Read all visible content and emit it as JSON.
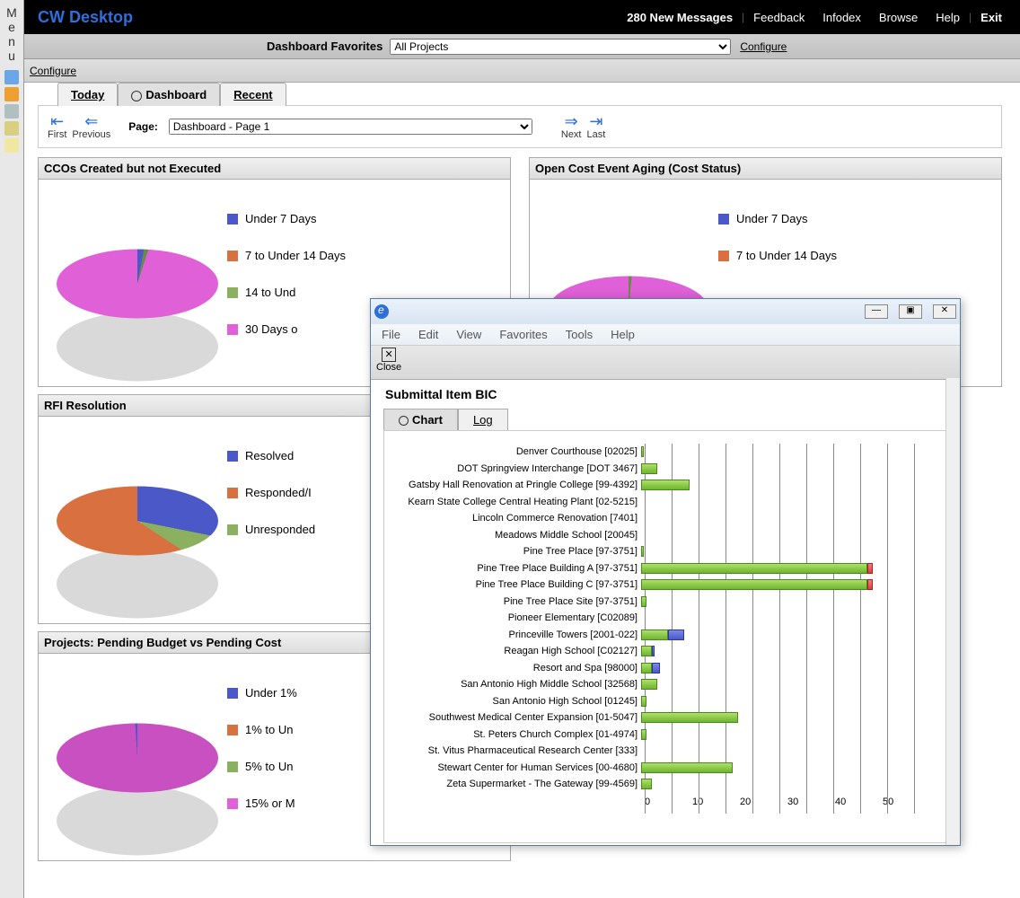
{
  "brand": "CW Desktop",
  "topbar": {
    "messages": "280 New Messages",
    "links": [
      "Feedback",
      "Infodex",
      "Browse",
      "Help"
    ],
    "exit": "Exit"
  },
  "leftmenu": {
    "label": "Menu"
  },
  "ribbon": {
    "label": "Dashboard Favorites",
    "selected": "All Projects",
    "configure": "Configure"
  },
  "ribbon2": {
    "configure": "Configure"
  },
  "tabs": {
    "today": "Today",
    "dashboard": "Dashboard",
    "recent": "Recent"
  },
  "pagenav": {
    "first": "First",
    "previous": "Previous",
    "page_label": "Page:",
    "page_selected": "Dashboard - Page 1",
    "next": "Next",
    "last": "Last"
  },
  "widgets": {
    "ccos": {
      "title": "CCOs Created but not Executed",
      "legend": [
        "Under 7 Days",
        "7 to Under 14 Days",
        "14 to Und",
        "30 Days o"
      ]
    },
    "open_cost": {
      "title": "Open Cost Event Aging (Cost Status)",
      "legend": [
        "Under 7 Days",
        "7 to Under 14 Days"
      ]
    },
    "rfi": {
      "title": "RFI Resolution",
      "legend": [
        "Resolved",
        "Responded/I",
        "Unresponded"
      ]
    },
    "projects": {
      "title": "Projects: Pending Budget vs Pending Cost",
      "legend": [
        "Under 1%",
        "1% to Un",
        "5% to Un",
        "15% or M"
      ]
    }
  },
  "popup": {
    "menu": [
      "File",
      "Edit",
      "View",
      "Favorites",
      "Tools",
      "Help"
    ],
    "close": "Close",
    "title": "Submittal Item BIC",
    "tabs": {
      "chart": "Chart",
      "log": "Log"
    },
    "xaxis": [
      "0",
      "10",
      "20",
      "30",
      "40",
      "50"
    ]
  },
  "chart_data": {
    "type": "bar",
    "orientation": "horizontal",
    "title": "Submittal Item BIC",
    "xlim": [
      0,
      50
    ],
    "categories": [
      "Denver Courthouse [02025]",
      "DOT Springview Interchange [DOT 3467]",
      "Gatsby Hall Renovation at Pringle College [99-4392]",
      "Kearn State College Central Heating Plant [02-5215]",
      "Lincoln Commerce Renovation [7401]",
      "Meadows Middle School [20045]",
      "Pine Tree Place [97-3751]",
      "Pine Tree Place Building A [97-3751]",
      "Pine Tree Place Building C [97-3751]",
      "Pine Tree Place Site [97-3751]",
      "Pioneer Elementary [C02089]",
      "Princeville Towers [2001-022]",
      "Reagan High School [C02127]",
      "Resort and Spa [98000]",
      "San Antonio High Middle School [32568]",
      "San Antonio High School [01245]",
      "Southwest Medical Center Expansion [01-5047]",
      "St. Peters Church Complex [01-4974]",
      "St. Vitus Pharmaceutical Research Center [333]",
      "Stewart Center for Human Services [00-4680]",
      "Zeta Supermarket - The Gateway [99-4569]"
    ],
    "series": [
      {
        "name": "green",
        "values": [
          0.5,
          3,
          9,
          0,
          0,
          0,
          0.5,
          42,
          42,
          1,
          0,
          5,
          2,
          2,
          3,
          1,
          18,
          1,
          0,
          17,
          2
        ]
      },
      {
        "name": "blue",
        "values": [
          0,
          0,
          0,
          0,
          0,
          0,
          0,
          0,
          0,
          0,
          0,
          3,
          0.5,
          1.5,
          0,
          0,
          0,
          0,
          0,
          0,
          0
        ]
      },
      {
        "name": "red",
        "values": [
          0,
          0,
          0,
          0,
          0,
          0,
          0,
          1,
          1,
          0,
          0,
          0,
          0,
          0,
          0,
          0,
          0,
          0,
          0,
          0,
          0
        ]
      }
    ]
  }
}
